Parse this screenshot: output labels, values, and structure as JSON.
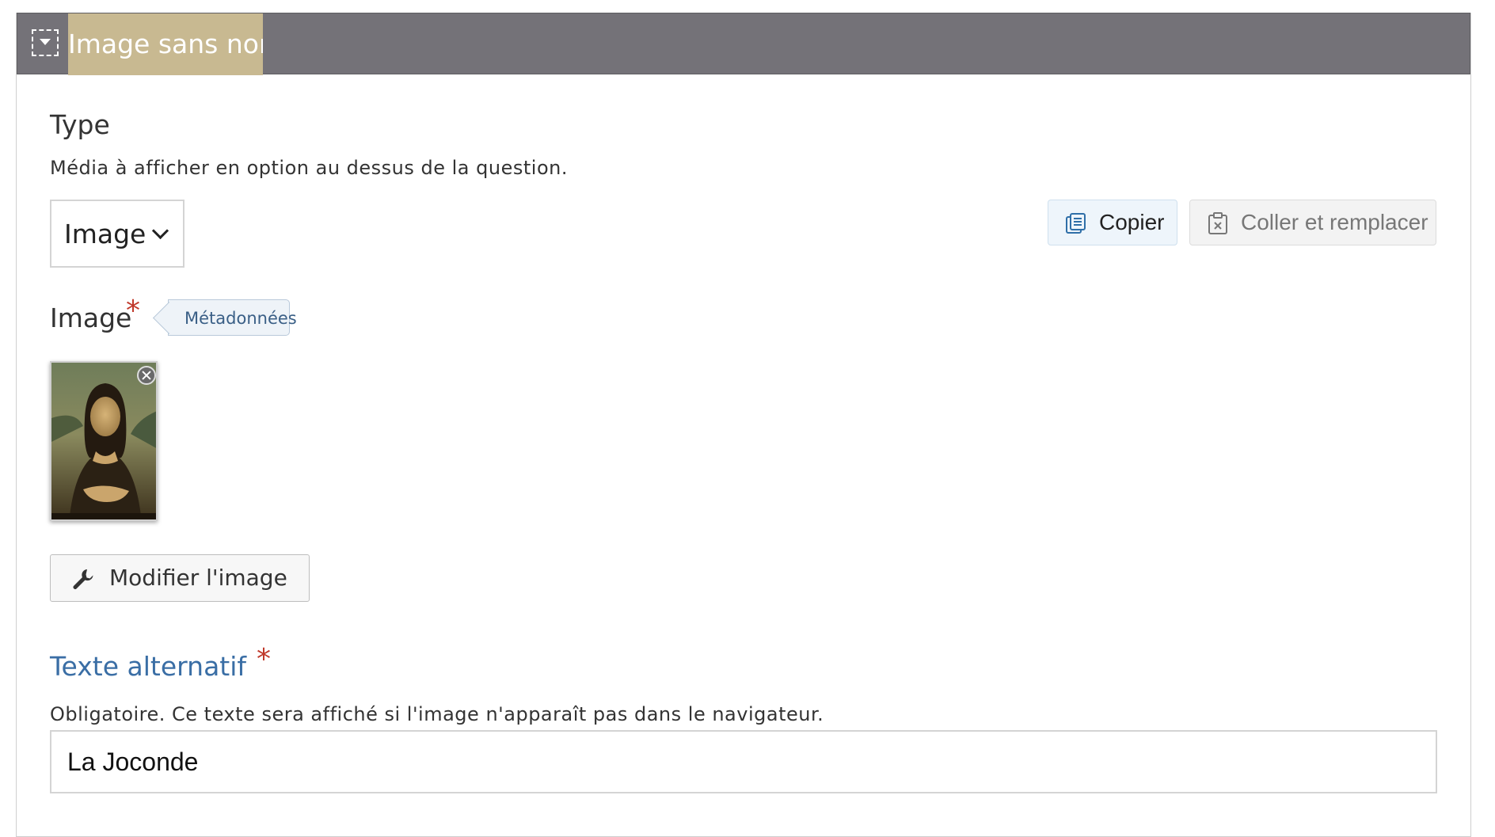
{
  "header": {
    "title": "Image sans nom"
  },
  "type_field": {
    "label": "Type",
    "description": "Média à afficher en option au dessus de la question.",
    "selected": "Image"
  },
  "actions": {
    "copy_label": "Copier",
    "paste_label": "Coller et remplacer"
  },
  "image_field": {
    "label": "Image",
    "required_mark": "*",
    "metadata_label": "Métadonnées",
    "edit_button_label": "Modifier l'image"
  },
  "alt_field": {
    "label": "Texte alternatif",
    "required_mark": "*",
    "description": "Obligatoire. Ce texte sera affiché si l'image n'apparaît pas dans le navigateur.",
    "value": "La Joconde"
  },
  "colors": {
    "header_bg": "#747278",
    "title_highlight": "#c8b991",
    "required": "#c0392b",
    "alt_label": "#3a6ea5"
  }
}
